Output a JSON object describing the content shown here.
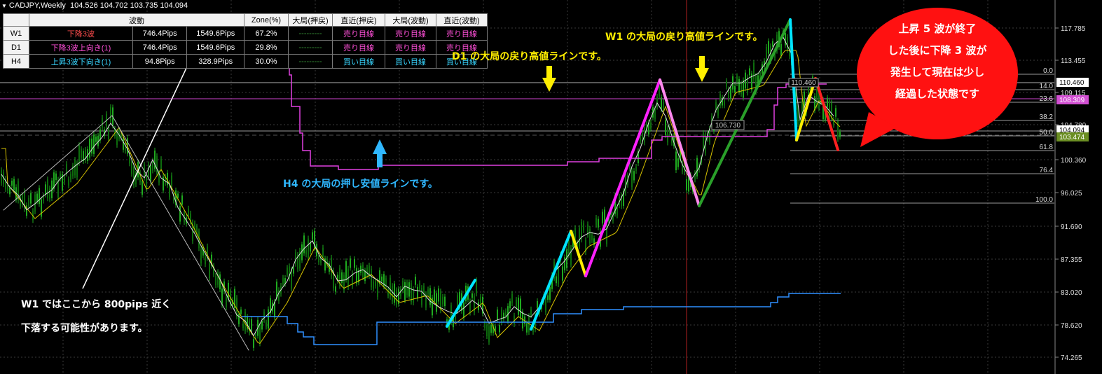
{
  "window": {
    "title": "CADJPY,Weekly",
    "ohlc": "104.526 104.702 103.735 104.094"
  },
  "wave_table": {
    "headers": [
      "",
      "波動",
      "",
      "Zone(%)",
      "大局(押戻)",
      "直近(押戻)",
      "大局(波動)",
      "直近(波動)"
    ],
    "rows": [
      {
        "tf": "W1",
        "wave": "下降3波",
        "pips1": "746.4Pips",
        "pips2": "1549.6Pips",
        "zone": "67.2%",
        "big_pull": "---------",
        "near_pull": "売り目線",
        "big_wave": "売り目線",
        "near_wave": "売り目線",
        "wave_color": "#ff4d4d",
        "near_color": "#ff4fd8"
      },
      {
        "tf": "D1",
        "wave": "下降3波上向き(1)",
        "pips1": "746.4Pips",
        "pips2": "1549.6Pips",
        "zone": "29.8%",
        "big_pull": "---------",
        "near_pull": "売り目線",
        "big_wave": "売り目線",
        "near_wave": "売り目線",
        "wave_color": "#ff4fd8",
        "near_color": "#ff4fd8"
      },
      {
        "tf": "H4",
        "wave": "上昇3波下向き(1)",
        "pips1": "94.8Pips",
        "pips2": "328.9Pips",
        "zone": "30.0%",
        "big_pull": "---------",
        "near_pull": "買い目線",
        "big_wave": "買い目線",
        "near_wave": "買い目線",
        "wave_color": "#38d6ff",
        "near_color": "#38d6ff"
      }
    ]
  },
  "annotations": {
    "w1_resistance": "W1 の大局の戻り高値ラインです。",
    "d1_resistance": "D1 の大局の戻り高値ラインです。",
    "h4_support": "H4 の大局の押し安値ラインです。",
    "w1_drop_line1": "W1 ではここから 800pips 近く",
    "w1_drop_line2": "下落する可能性があります。",
    "bubble_lines": [
      "上昇 5 波が終了",
      "した後に下降 3 波が",
      "発生して現在は少し",
      "経過した状態です"
    ]
  },
  "price_axis": {
    "ticks": [
      "117.785",
      "113.455",
      "109.115",
      "104.780",
      "100.360",
      "96.025",
      "91.690",
      "87.355",
      "83.020",
      "78.620",
      "74.265"
    ],
    "tags": [
      {
        "label": "110.460",
        "bg": "#ffffff",
        "fg": "#000000"
      },
      {
        "label": "108.309",
        "bg": "#d24fd2",
        "fg": "#ffffff"
      },
      {
        "label": "104.094",
        "bg": "#ffffff",
        "fg": "#000000"
      },
      {
        "label": "103.474",
        "bg": "#6b8e23",
        "fg": "#ffffff"
      }
    ]
  },
  "fib_levels": [
    "0.0",
    "14.0",
    "23.6",
    "38.2",
    "50.0",
    "61.8",
    "76.4",
    "100.0"
  ],
  "chart_labels": {
    "level_106": "106.730",
    "level_110": "110.460"
  },
  "colors": {
    "background": "#000000",
    "candles": "#1faa1f",
    "magenta_line": "#e040e0",
    "blue_line": "#2f8fff",
    "cyan_wave": "#00e5ff",
    "yellow_wave": "#ffee00",
    "magenta_wave": "#ff22ff",
    "green_wave": "#2aa02a",
    "red_wave": "#ff2020",
    "annot_yellow": "#ffee00",
    "annot_cyan": "#2fb7ff",
    "bubble": "#ff1111"
  }
}
